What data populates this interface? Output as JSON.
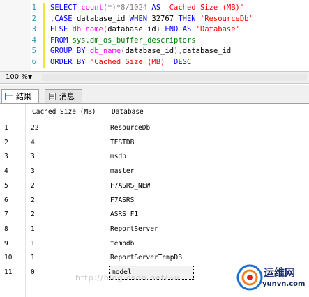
{
  "editor": {
    "lines": [
      {
        "num": "1",
        "tokens": [
          {
            "t": "SELECT ",
            "c": "kw"
          },
          {
            "t": "count",
            "c": "fn"
          },
          {
            "t": "(*)*8/1024 ",
            "c": "op"
          },
          {
            "t": "AS ",
            "c": "kw"
          },
          {
            "t": "'Cached Size (MB)'",
            "c": "str"
          }
        ]
      },
      {
        "num": "2",
        "tokens": [
          {
            "t": ",",
            "c": "op"
          },
          {
            "t": "CASE ",
            "c": "kw"
          },
          {
            "t": "database_id ",
            "c": "txt"
          },
          {
            "t": "WHEN ",
            "c": "kw"
          },
          {
            "t": "32767 ",
            "c": "txt"
          },
          {
            "t": "THEN ",
            "c": "kw"
          },
          {
            "t": "'ResourceDb'",
            "c": "str"
          }
        ]
      },
      {
        "num": "3",
        "tokens": [
          {
            "t": "ELSE ",
            "c": "kw"
          },
          {
            "t": "db_name",
            "c": "fn"
          },
          {
            "t": "(",
            "c": "op"
          },
          {
            "t": "database_id",
            "c": "txt"
          },
          {
            "t": ") ",
            "c": "op"
          },
          {
            "t": "END AS ",
            "c": "kw"
          },
          {
            "t": "'Database'",
            "c": "str"
          }
        ]
      },
      {
        "num": "4",
        "tokens": [
          {
            "t": "FROM ",
            "c": "kw"
          },
          {
            "t": "sys.dm_os_buffer_descriptors",
            "c": "sys"
          }
        ]
      },
      {
        "num": "5",
        "tokens": [
          {
            "t": "GROUP BY ",
            "c": "kw"
          },
          {
            "t": "db_name",
            "c": "fn"
          },
          {
            "t": "(",
            "c": "op"
          },
          {
            "t": "database_id",
            "c": "txt"
          },
          {
            "t": "),",
            "c": "op"
          },
          {
            "t": "database_id",
            "c": "txt"
          }
        ]
      },
      {
        "num": "6",
        "tokens": [
          {
            "t": "ORDER BY ",
            "c": "kw"
          },
          {
            "t": "'Cached Size (MB)' ",
            "c": "str"
          },
          {
            "t": "DESC",
            "c": "kw"
          }
        ]
      }
    ]
  },
  "zoom": {
    "value": "100 %"
  },
  "tabs": [
    {
      "label": "结果",
      "icon": "grid-icon"
    },
    {
      "label": "消息",
      "icon": "message-icon"
    }
  ],
  "grid": {
    "columns": [
      "Cached Size (MB)",
      "Database"
    ],
    "rows": [
      {
        "num": "1",
        "size": "22",
        "db": "ResourceDb"
      },
      {
        "num": "2",
        "size": "4",
        "db": "TESTDB"
      },
      {
        "num": "3",
        "size": "3",
        "db": "msdb"
      },
      {
        "num": "4",
        "size": "3",
        "db": "master"
      },
      {
        "num": "5",
        "size": "2",
        "db": "F7ASRS_NEW"
      },
      {
        "num": "6",
        "size": "2",
        "db": "F7ASRS"
      },
      {
        "num": "7",
        "size": "2",
        "db": "ASRS_F1"
      },
      {
        "num": "8",
        "size": "1",
        "db": "ReportServer"
      },
      {
        "num": "9",
        "size": "1",
        "db": "tempdb"
      },
      {
        "num": "10",
        "size": "1",
        "db": "ReportServerTempDB"
      },
      {
        "num": "11",
        "size": "0",
        "db": "model"
      }
    ]
  },
  "watermark": {
    "text": "http://blog.csdn.net/Bu",
    "logo_cn": "运维网",
    "logo_en": "yunvn.com"
  }
}
